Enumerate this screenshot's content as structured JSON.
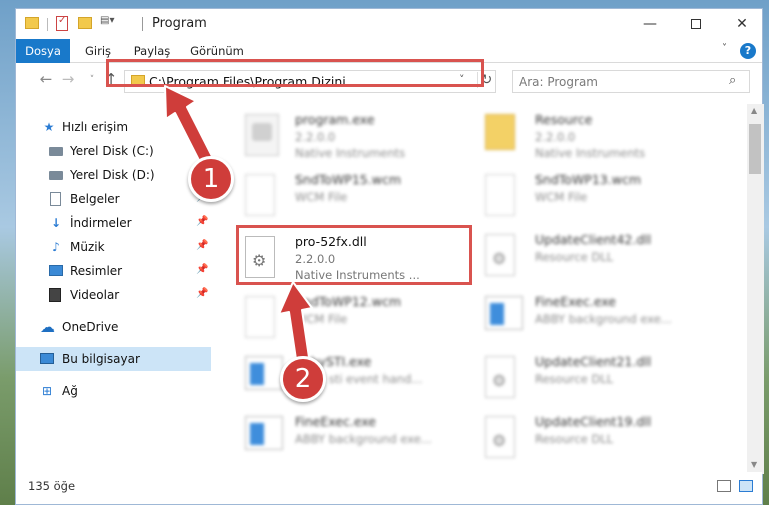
{
  "window": {
    "title": "Program",
    "minimize_glyph": "—",
    "close_glyph": "✕"
  },
  "ribbon": {
    "tabs": [
      "Dosya",
      "Giriş",
      "Paylaş",
      "Görünüm"
    ],
    "expand_glyph": "˅",
    "help_glyph": "?"
  },
  "navigation": {
    "back_glyph": "←",
    "forward_glyph": "→",
    "recent_glyph": "˅",
    "up_glyph": "↑",
    "address": "C:\\Program Files\\Program Dizini",
    "address_dropdown_glyph": "˅",
    "refresh_glyph": "↻",
    "search_placeholder": "Ara: Program",
    "search_glyph": "⌕"
  },
  "sidebar": {
    "items": [
      {
        "label": "Hızlı erişim",
        "icon": "star-icon",
        "pinned": false
      },
      {
        "label": "Yerel Disk (C:)",
        "icon": "drive-icon",
        "pinned": true
      },
      {
        "label": "Yerel Disk (D:)",
        "icon": "drive-icon",
        "pinned": true
      },
      {
        "label": "Belgeler",
        "icon": "document-icon",
        "pinned": true
      },
      {
        "label": "İndirmeler",
        "icon": "download-icon",
        "pinned": true
      },
      {
        "label": "Müzik",
        "icon": "music-icon",
        "pinned": true
      },
      {
        "label": "Resimler",
        "icon": "pictures-icon",
        "pinned": true
      },
      {
        "label": "Videolar",
        "icon": "video-icon",
        "pinned": true
      },
      {
        "label": "OneDrive",
        "icon": "cloud-icon",
        "pinned": false
      },
      {
        "label": "Bu bilgisayar",
        "icon": "computer-icon",
        "pinned": false,
        "selected": true
      },
      {
        "label": "Ağ",
        "icon": "network-icon",
        "pinned": false
      }
    ],
    "pin_glyph": "📌"
  },
  "files": [
    {
      "name": "program.exe",
      "line2": "2.2.0.0",
      "line3": "Native Instruments",
      "icon": "exe-icon"
    },
    {
      "name": "Resource",
      "line2": "2.2.0.0",
      "line3": "Native Instruments",
      "icon": "folder-icon"
    },
    {
      "name": "SndToWP15.wcm",
      "line2": "WCM File",
      "line3": "",
      "icon": "file-icon"
    },
    {
      "name": "SndToWP13.wcm",
      "line2": "WCM File",
      "line3": "",
      "icon": "file-icon"
    },
    {
      "name": "pro-52fx.dll",
      "line2": "2.2.0.0",
      "line3": "Native Instruments ...",
      "icon": "dll-icon"
    },
    {
      "name": "UpdateClient42.dll",
      "line2": "Resource DLL",
      "line3": "",
      "icon": "dll-icon"
    },
    {
      "name": "SndToWP12.wcm",
      "line2": "WCM File",
      "line3": "",
      "icon": "file-icon"
    },
    {
      "name": "FineExec.exe",
      "line2": "ABBY background exe...",
      "line3": "",
      "icon": "app-icon"
    },
    {
      "name": "ebbySTI.exe",
      "line2": "ABBY sti event hand...",
      "line3": "",
      "icon": "app-icon"
    },
    {
      "name": "UpdateClient21.dll",
      "line2": "Resource DLL",
      "line3": "",
      "icon": "dll-icon"
    },
    {
      "name": "FineExec.exe",
      "line2": "ABBY background exe...",
      "line3": "",
      "icon": "app-icon"
    },
    {
      "name": "UpdateClient19.dll",
      "line2": "Resource DLL",
      "line3": "",
      "icon": "dll-icon"
    }
  ],
  "status": {
    "item_count": "135 öğe"
  },
  "annotations": {
    "marker1": "1",
    "marker2": "2",
    "color": "#cf3d3a"
  }
}
